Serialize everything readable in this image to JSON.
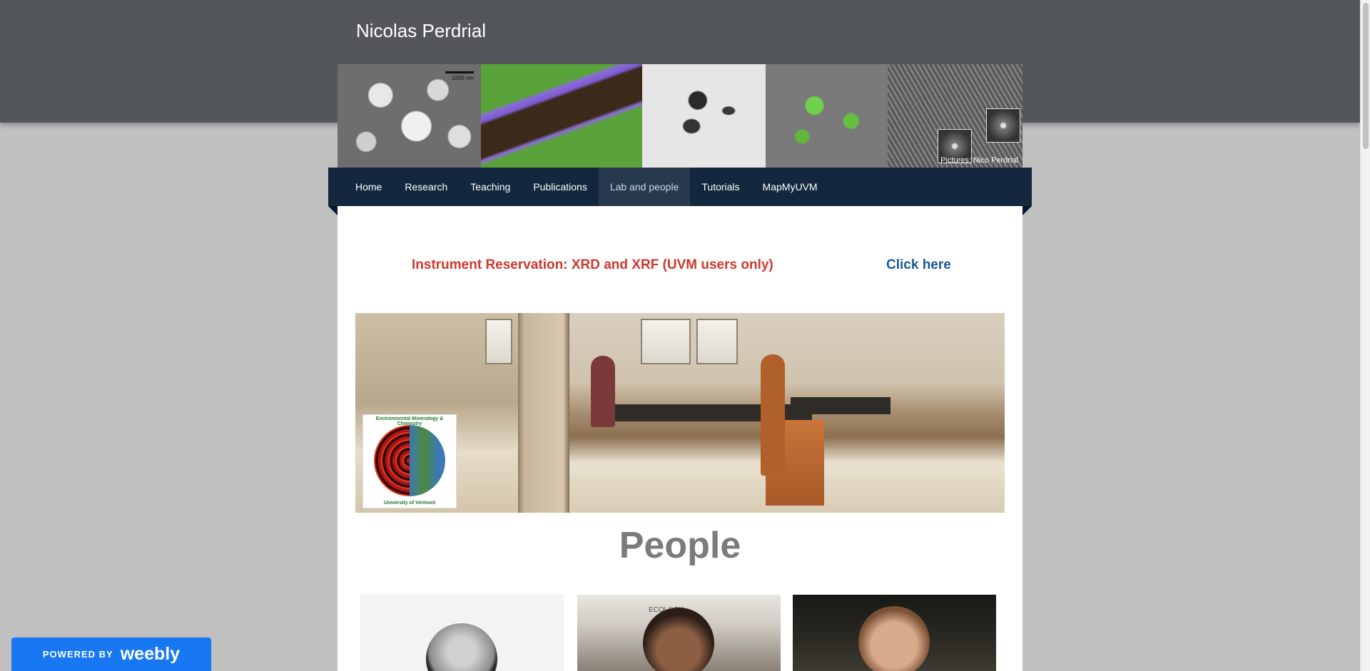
{
  "site": {
    "title": "Nicolas Perdrial"
  },
  "banner": {
    "scale_label": "1000 nm",
    "credit": "Pictures: Nico Perdrial"
  },
  "nav": {
    "items": [
      {
        "label": "Home",
        "active": false
      },
      {
        "label": "Research",
        "active": false
      },
      {
        "label": "Teaching",
        "active": false
      },
      {
        "label": "Publications",
        "active": false
      },
      {
        "label": "Lab and people",
        "active": true
      },
      {
        "label": "Tutorials",
        "active": false
      },
      {
        "label": "MapMyUVM",
        "active": false
      }
    ]
  },
  "reservation": {
    "text": "Instrument Reservation: XRD and XRF (UVM users only)",
    "link_label": "Click here",
    "text_color": "#d0382d",
    "link_color": "#1a5a96"
  },
  "lab_logo": {
    "top_text": "Environmental Mineralogy & Chemistry",
    "bottom_text": "University of Vermont"
  },
  "people": {
    "heading": "People",
    "poster_text": "ECOLOGY"
  },
  "badge": {
    "powered_by": "POWERED BY",
    "brand": "weebly",
    "color": "#1878f3"
  },
  "colors": {
    "header_bg": "#53575b",
    "nav_bg": "#13283e",
    "page_bg": "#c0c0c0"
  }
}
